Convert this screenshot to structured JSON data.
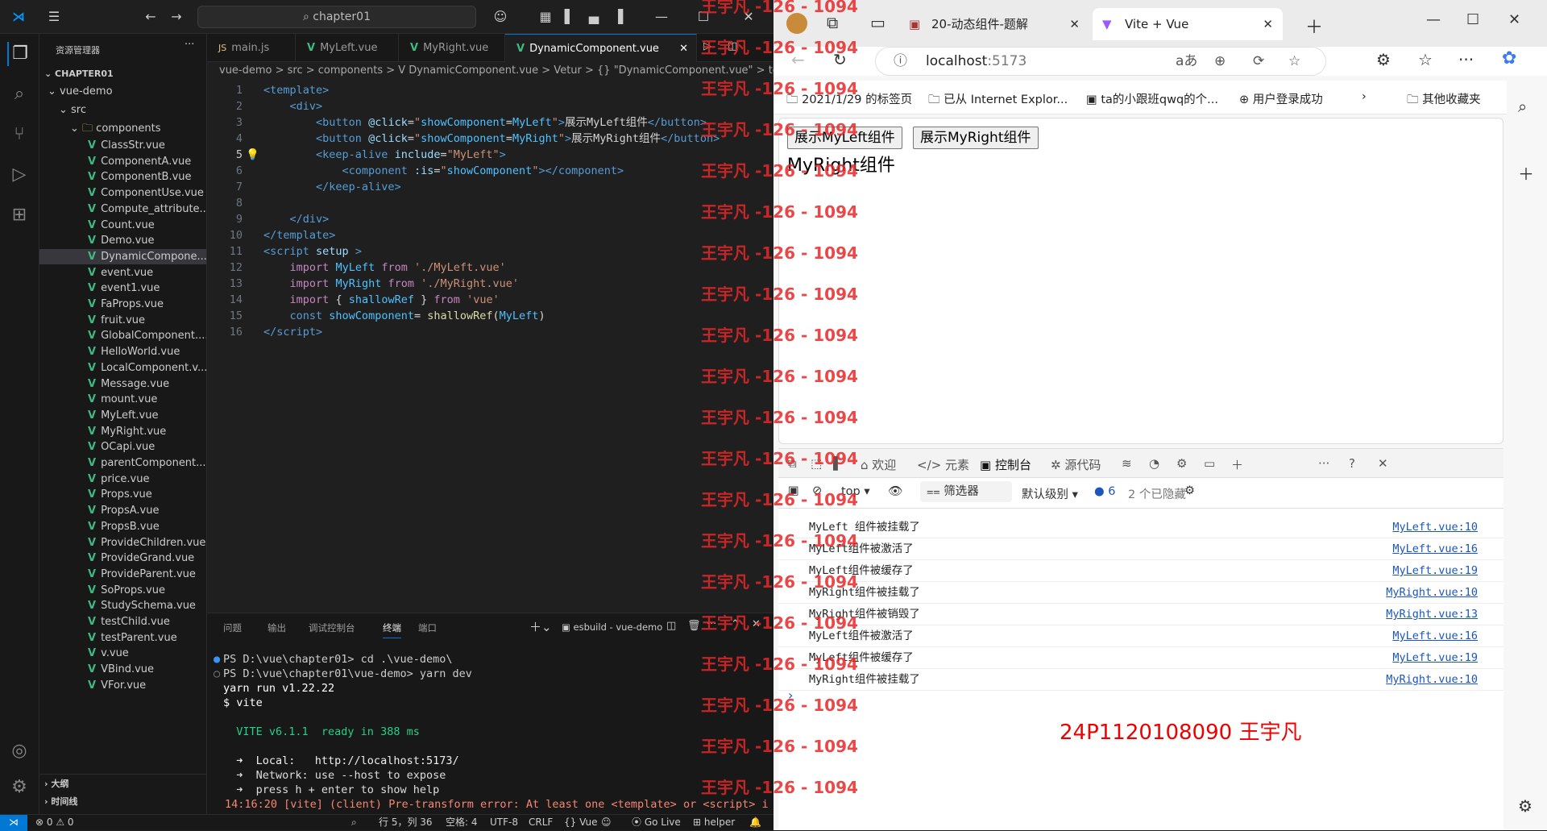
{
  "vscode": {
    "search": "chapter01",
    "explorer_title": "资源管理器",
    "project": "CHAPTER01",
    "folders": [
      "vue-demo",
      "src",
      "components"
    ],
    "files": [
      "ClassStr.vue",
      "ComponentA.vue",
      "ComponentB.vue",
      "ComponentUse.vue",
      "Compute_attribute...",
      "Count.vue",
      "Demo.vue",
      "DynamicCompone...",
      "event.vue",
      "event1.vue",
      "FaProps.vue",
      "fruit.vue",
      "GlobalComponent....",
      "HelloWorld.vue",
      "LocalComponent.v...",
      "Message.vue",
      "mount.vue",
      "MyLeft.vue",
      "MyRight.vue",
      "OCapi.vue",
      "parentComponent....",
      "price.vue",
      "Props.vue",
      "PropsA.vue",
      "PropsB.vue",
      "ProvideChildren.vue",
      "ProvideGrand.vue",
      "ProvideParent.vue",
      "SoProps.vue",
      "StudySchema.vue",
      "testChild.vue",
      "testParent.vue",
      "v.vue",
      "VBind.vue",
      "VFor.vue"
    ],
    "outline": "大纲",
    "timeline": "时间线",
    "tabs": [
      "main.js",
      "MyLeft.vue",
      "MyRight.vue",
      "DynamicComponent.vue"
    ],
    "breadcrumb": "vue-demo > src > components > V DynamicComponent.vue > Vetur > {} \"DynamicComponent.vue\" > templ",
    "panel_tabs": [
      "问题",
      "输出",
      "调试控制台",
      "终端",
      "端口"
    ],
    "terminal_name": "esbuild - vue-demo",
    "terminal": [
      "PS D:\\vue\\chapter01> cd .\\vue-demo\\",
      "PS D:\\vue\\chapter01\\vue-demo> yarn dev",
      "yarn run v1.22.22",
      "$ vite",
      "",
      "  VITE v6.1.1  ready in 388 ms",
      "",
      "  ➜  Local:   http://localhost:5173/",
      "  ➜  Network: use --host to expose",
      "  ➜  press h + enter to show help",
      "14:16:20 [vite] (client) Pre-transform error: At least one <template> or <script> i"
    ],
    "status": {
      "errors": "⊗ 0 ⚠ 0",
      "pos": "行 5，列 36",
      "spaces": "空格: 4",
      "enc": "UTF-8",
      "eol": "CRLF",
      "lang": "{} Vue",
      "live": "Go Live",
      "helper": "helper"
    }
  },
  "edge": {
    "tabs": [
      "20-动态组件-题解",
      "Vite + Vue"
    ],
    "url_host": "localhost",
    "url_port": ":5173",
    "favorites": [
      "2021/1/29 的标签页",
      "已从 Internet Explor...",
      "ta的小跟班qwq的个...",
      "用户登录成功",
      "其他收藏夹"
    ],
    "page_buttons": [
      "展示MyLeft组件",
      "展示MyRight组件"
    ],
    "page_text": "MyRight组件",
    "devtools_tabs": [
      "欢迎",
      "元素",
      "控制台",
      "源代码"
    ],
    "console_context": "top",
    "filter": "筛选器",
    "level": "默认级别",
    "msg_count": "6",
    "hidden": "2 个已隐藏",
    "console": [
      {
        "msg": "MyLeft 组件被挂载了",
        "src": "MyLeft.vue:10"
      },
      {
        "msg": "MyLeft组件被激活了",
        "src": "MyLeft.vue:16"
      },
      {
        "msg": "MyLeft组件被缓存了",
        "src": "MyLeft.vue:19"
      },
      {
        "msg": "MyRight组件被挂载了",
        "src": "MyRight.vue:10"
      },
      {
        "msg": "MyRight组件被销毁了",
        "src": "MyRight.vue:13"
      },
      {
        "msg": "MyLeft组件被激活了",
        "src": "MyLeft.vue:16"
      },
      {
        "msg": "MyLeft组件被缓存了",
        "src": "MyLeft.vue:19"
      },
      {
        "msg": "MyRight组件被挂载了",
        "src": "MyRight.vue:10"
      }
    ],
    "stamp": "24P1120108090 王宇凡",
    "watermark": "王宇凡 -126 - 1094"
  }
}
